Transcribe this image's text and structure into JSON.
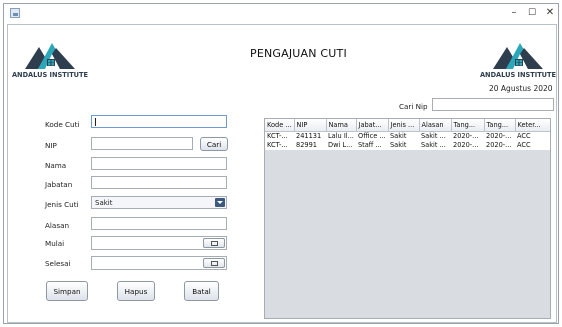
{
  "window": {
    "minimize_glyph": "–",
    "maximize_glyph": "☐",
    "close_glyph": "✕"
  },
  "header": {
    "logo_text": "ANDALUS INSTITUTE",
    "title": "PENGAJUAN CUTI",
    "date": "20 Agustus 2020"
  },
  "colors": {
    "logo_peak_dark": "#2f3e4e",
    "logo_peak_teal": "#2aa7b8",
    "logo_house": "#2f3e4e",
    "table_background": "#d9dde2"
  },
  "search": {
    "label": "Cari Nip",
    "value": ""
  },
  "form": {
    "kode_cuti": {
      "label": "Kode Cuti",
      "value": ""
    },
    "nip": {
      "label": "NIP",
      "value": "",
      "button": "Cari"
    },
    "nama": {
      "label": "Nama",
      "value": ""
    },
    "jabatan": {
      "label": "Jabatan",
      "value": ""
    },
    "jenis_cuti": {
      "label": "Jenis Cuti",
      "selected": "Sakit"
    },
    "alasan": {
      "label": "Alasan",
      "value": ""
    },
    "mulai": {
      "label": "Mulai",
      "value": "",
      "calendar_icon": "calendar-icon"
    },
    "selesai": {
      "label": "Selesai",
      "value": "",
      "calendar_icon": "calendar-icon"
    }
  },
  "buttons": {
    "simpan": "Simpan",
    "hapus": "Hapus",
    "batal": "Batal"
  },
  "table": {
    "columns": [
      "Kode ...",
      "NIP",
      "Nama",
      "Jabat...",
      "Jenis ...",
      "Alasan",
      "Tang...",
      "Tang...",
      "Keter..."
    ],
    "rows": [
      [
        "KCT-...",
        "241131",
        "Lalu Il...",
        "Office ...",
        "Sakit",
        "Sakit ...",
        "2020-...",
        "2020-...",
        "ACC"
      ],
      [
        "KCT-...",
        "82991",
        "Dwi L...",
        "Staff ...",
        "Sakit",
        "Sakit ...",
        "2020-...",
        "2020-...",
        "ACC"
      ]
    ]
  }
}
